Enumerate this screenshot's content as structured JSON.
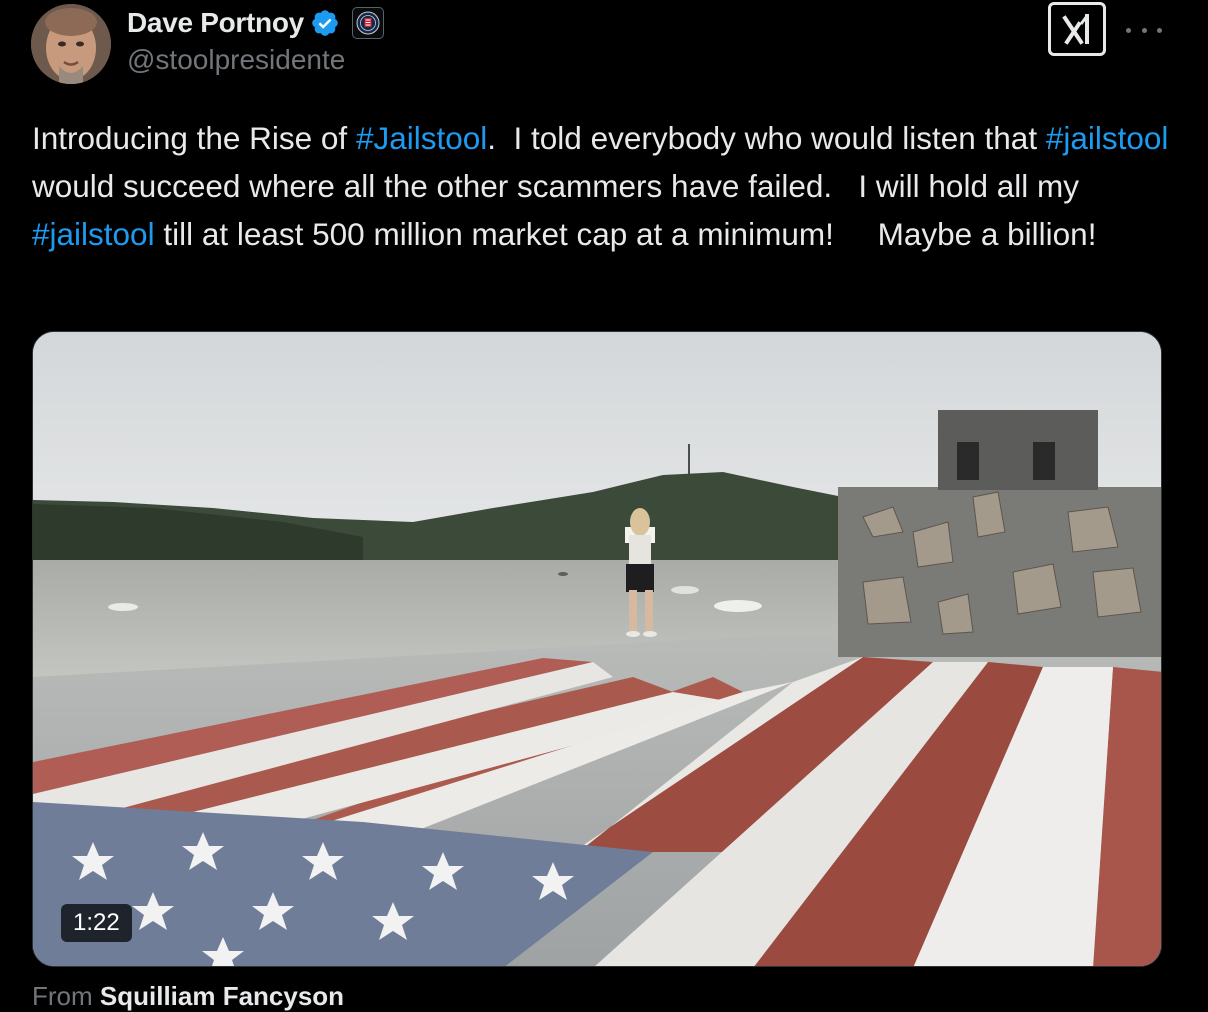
{
  "author": {
    "display_name": "Dave Portnoy",
    "handle": "@stoolpresidente",
    "verified_icon": "verified-badge-icon",
    "affiliate_icon": "barstool-affiliate-icon",
    "avatar_icon": "profile-avatar"
  },
  "actions": {
    "grok_icon": "grok-icon",
    "more_icon": "more-options-icon"
  },
  "tweet": {
    "t1": "Introducing the Rise of ",
    "h1": "#Jailstool",
    "t2": ".  I told everybody who would listen that ",
    "h2": "#jailstool",
    "t3": " would succeed where all the other scammers have failed.   I will hold all my ",
    "h3": "#jailstool",
    "t4": " till at least 500 million market cap at a minimum!     Maybe a billion!"
  },
  "media": {
    "duration": "1:22",
    "description_icon": "video-thumbnail"
  },
  "source": {
    "prefix": "From ",
    "name": "Squilliam Fancyson"
  },
  "colors": {
    "background": "#000000",
    "text": "#e7e9ea",
    "secondary": "#71767b",
    "link": "#1d9bf0",
    "verified": "#1d9bf0"
  }
}
